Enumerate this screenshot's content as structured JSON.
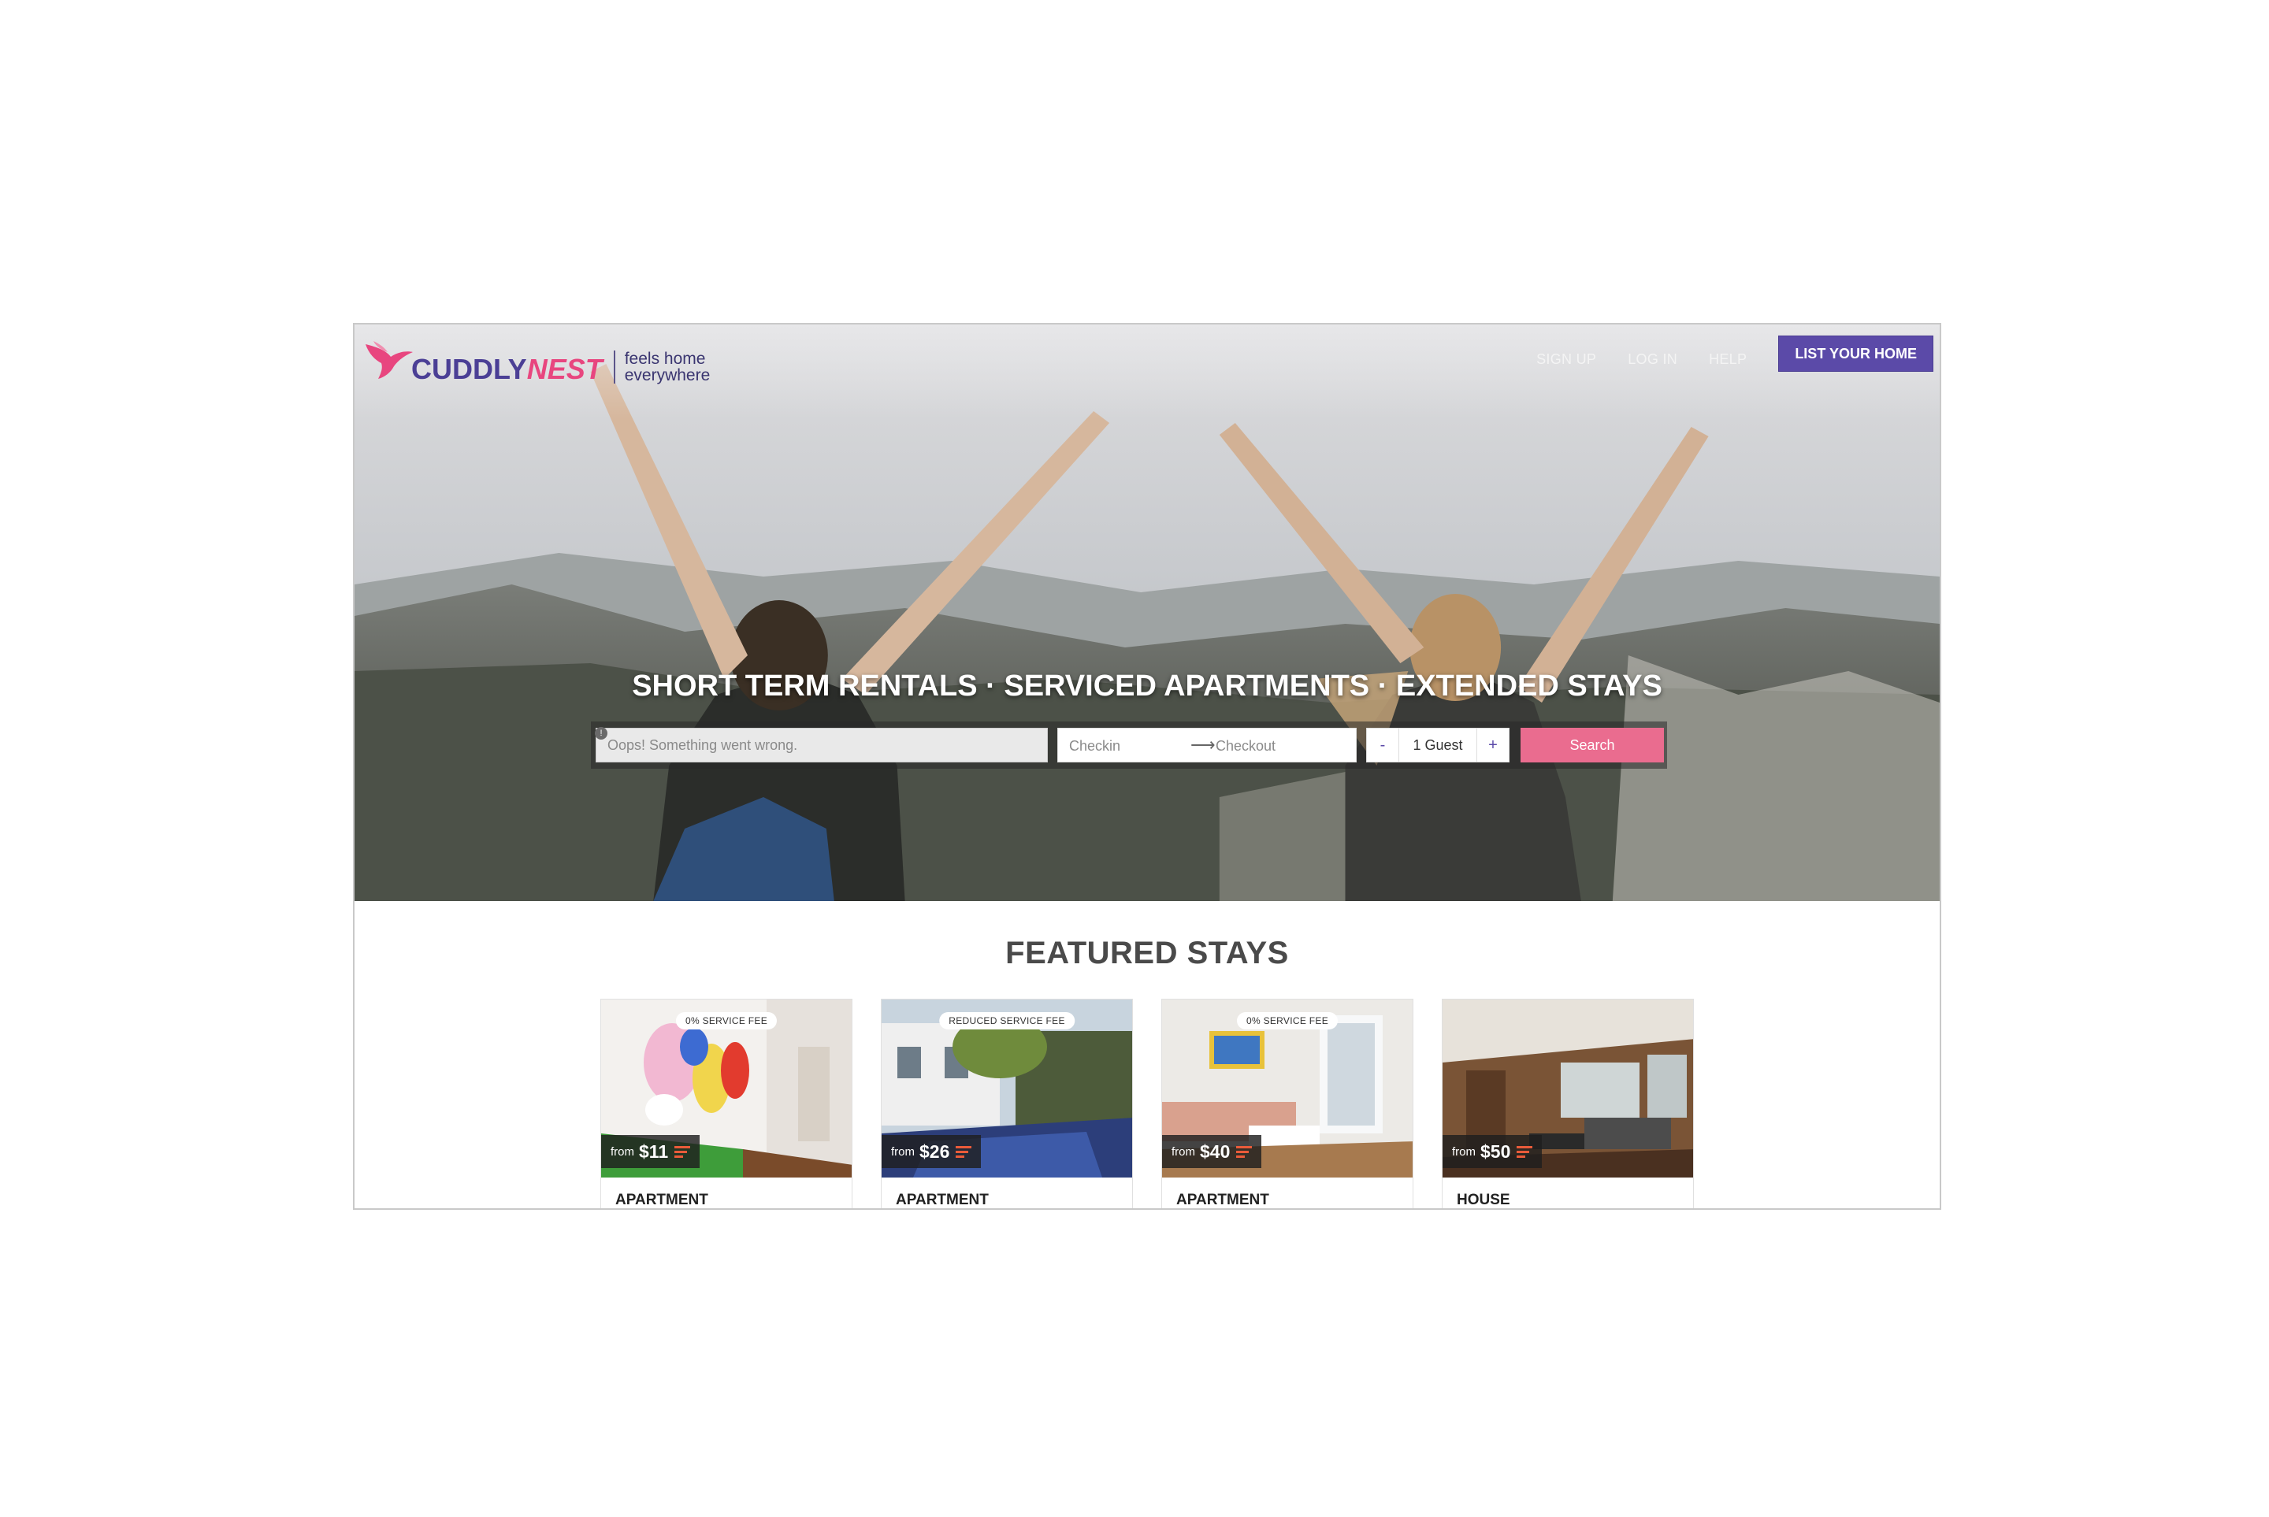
{
  "header": {
    "logo": {
      "word_part1": "CUDDLY",
      "word_part2": "NEST",
      "tagline_line1": "feels home",
      "tagline_line2": "everywhere"
    },
    "nav": {
      "sign_up": "SIGN UP",
      "log_in": "LOG IN",
      "help": "HELP",
      "list_your_home": "LIST YOUR HOME"
    }
  },
  "hero": {
    "headline": "SHORT TERM RENTALS · SERVICED APARTMENTS · EXTENDED STAYS",
    "search": {
      "location_placeholder": "Oops! Something went wrong.",
      "location_error_icon": "!",
      "checkin": "Checkin",
      "arrow": "⟶",
      "checkout": "Checkout",
      "guests_minus": "-",
      "guests_value": "1 Guest",
      "guests_plus": "+",
      "search_button": "Search"
    }
  },
  "featured": {
    "title": "FEATURED STAYS",
    "cards": [
      {
        "badge": "0% SERVICE FEE",
        "from": "from",
        "price": "$11",
        "type": "APARTMENT"
      },
      {
        "badge": "REDUCED SERVICE FEE",
        "from": "from",
        "price": "$26",
        "type": "APARTMENT"
      },
      {
        "badge": "0% SERVICE FEE",
        "from": "from",
        "price": "$40",
        "type": "APARTMENT"
      },
      {
        "badge": "",
        "from": "from",
        "price": "$50",
        "type": "HOUSE"
      }
    ]
  },
  "colors": {
    "brand_purple": "#5b4aa8",
    "brand_pink": "#e8467f",
    "search_button": "#ea6c8f"
  }
}
